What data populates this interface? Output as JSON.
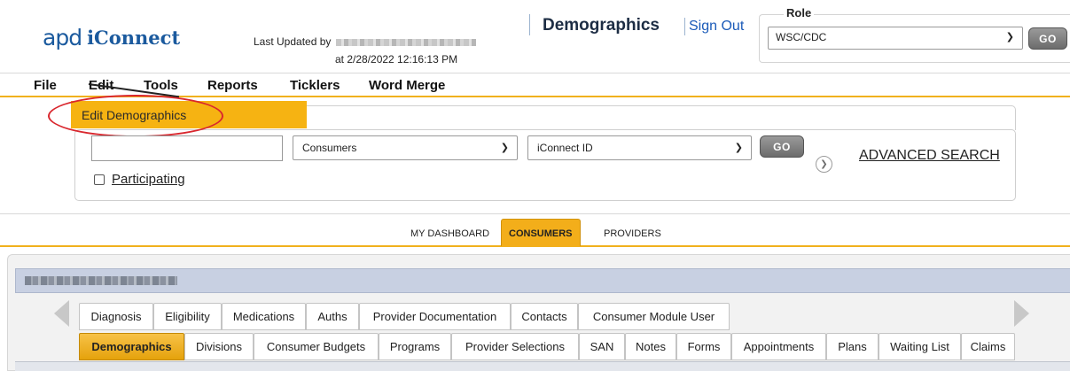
{
  "header": {
    "logo_apd": "apd",
    "logo_iconnect": "iConnect",
    "last_updated_prefix": "Last Updated by",
    "last_updated_at": "at 2/28/2022 12:16:13 PM",
    "page_title": "Demographics",
    "sign_out": "Sign Out",
    "role_label": "Role",
    "role_value": "WSC/CDC",
    "role_go": "GO"
  },
  "menubar": {
    "items": [
      "File",
      "Edit",
      "Tools",
      "Reports",
      "Ticklers",
      "Word Merge"
    ],
    "edit_dropdown": [
      "Edit Demographics"
    ]
  },
  "search": {
    "input_value": "",
    "type_value": "Consumers",
    "field_value": "iConnect ID",
    "go": "GO",
    "participating_label": "Participating",
    "participating_checked": false,
    "advanced_search": "ADVANCED SEARCH"
  },
  "nav_tabs": {
    "items": [
      "MY DASHBOARD",
      "CONSUMERS",
      "PROVIDERS"
    ],
    "active": "CONSUMERS"
  },
  "consumer_tabs": {
    "row1": [
      "Diagnosis",
      "Eligibility",
      "Medications",
      "Auths",
      "Provider Documentation",
      "Contacts",
      "Consumer Module User"
    ],
    "row2": [
      "Demographics",
      "Divisions",
      "Consumer Budgets",
      "Programs",
      "Provider Selections",
      "SAN",
      "Notes",
      "Forms",
      "Appointments",
      "Plans",
      "Waiting List",
      "Claims"
    ],
    "active": "Demographics"
  },
  "colors": {
    "accent": "#f3ae1a",
    "link": "#1a5ab8",
    "annotation": "#d9272e"
  },
  "icons": {
    "expand": "chevron-down-circle-icon",
    "scroll_left": "arrow-left-icon",
    "scroll_right": "arrow-right-icon",
    "select": "chevron-down-icon"
  }
}
